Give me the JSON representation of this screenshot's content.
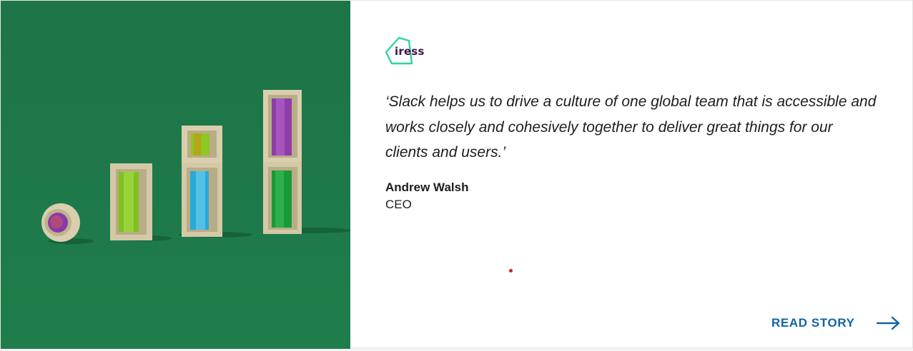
{
  "story_card": {
    "image": {
      "description": "",
      "background_color": "#1f7a4a"
    },
    "logo": {
      "text": "iress",
      "accent_color": "#2fd4a0"
    },
    "quote": "‘Slack helps us to drive a culture of one global team that is accessible and works closely and cohesively together to deliver great things for our clients and users.’",
    "author": {
      "name": "Andrew Walsh",
      "title": "CEO"
    },
    "cta": {
      "label": "READ STORY",
      "icon": "arrow-right-icon",
      "color": "#1264a3"
    }
  }
}
